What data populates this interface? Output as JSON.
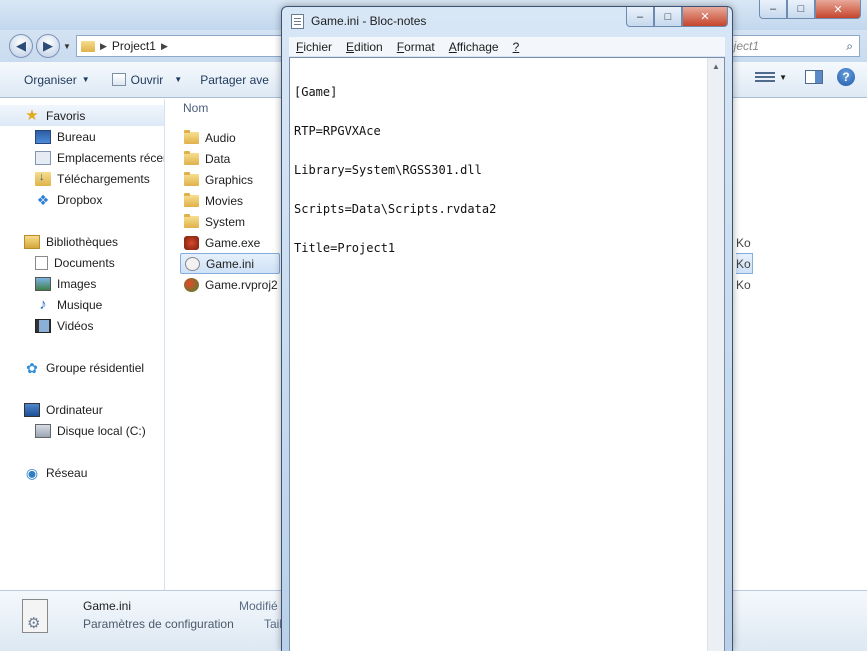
{
  "explorer": {
    "caption_buttons": [
      "–",
      "□",
      "✕"
    ],
    "address": {
      "segments": [
        "Project1"
      ]
    },
    "search": {
      "placeholder": "oject1"
    },
    "toolbar": {
      "organize": "Organiser",
      "open": "Ouvrir",
      "share": "Partager ave"
    },
    "nav": {
      "favorites": {
        "label": "Favoris",
        "items": [
          "Bureau",
          "Emplacements récer",
          "Téléchargements",
          "Dropbox"
        ]
      },
      "libraries": {
        "label": "Bibliothèques",
        "items": [
          "Documents",
          "Images",
          "Musique",
          "Vidéos"
        ]
      },
      "homegroup": {
        "label": "Groupe résidentiel"
      },
      "computer": {
        "label": "Ordinateur",
        "items": [
          "Disque local (C:)"
        ]
      },
      "network": {
        "label": "Réseau"
      }
    },
    "files": {
      "column_name": "Nom",
      "items": [
        {
          "name": "Audio",
          "type": "folder"
        },
        {
          "name": "Data",
          "type": "folder"
        },
        {
          "name": "Graphics",
          "type": "folder"
        },
        {
          "name": "Movies",
          "type": "folder"
        },
        {
          "name": "System",
          "type": "folder"
        },
        {
          "name": "Game.exe",
          "type": "exe",
          "size_suffix": "Ko"
        },
        {
          "name": "Game.ini",
          "type": "ini",
          "size_suffix": "Ko",
          "selected": true
        },
        {
          "name": "Game.rvproj2",
          "type": "rvproj",
          "size_suffix": "Ko"
        }
      ]
    },
    "details": {
      "name": "Game.ini",
      "type": "Paramètres de configuration",
      "modified_label": "Modifié",
      "size_label": "Taill"
    }
  },
  "notepad": {
    "title": "Game.ini - Bloc-notes",
    "menu": [
      {
        "acc": "F",
        "rest": "ichier"
      },
      {
        "acc": "E",
        "rest": "dition"
      },
      {
        "acc": "F",
        "rest": "ormat"
      },
      {
        "acc": "A",
        "rest": "ffichage"
      },
      {
        "acc": "?",
        "rest": ""
      }
    ],
    "lines": [
      "[Game]",
      "RTP=RPGVXAce",
      "Library=System\\RGSS301.dll",
      "Scripts=Data\\Scripts.rvdata2",
      "Title=Project1"
    ]
  }
}
